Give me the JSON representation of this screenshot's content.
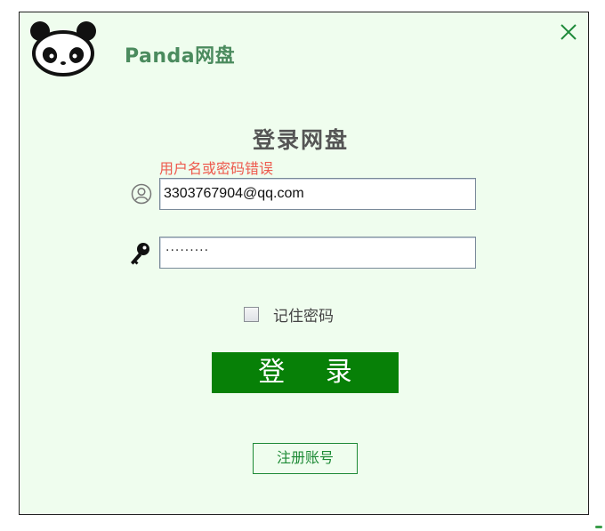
{
  "app": {
    "title": "Panda网盘"
  },
  "login": {
    "heading": "登录网盘",
    "error": "用户名或密码错误",
    "username_value": "3303767904@qq.com",
    "password_mask": "·········",
    "remember_label": "记住密码",
    "remember_checked": false,
    "login_button": "登 录",
    "register_button": "注册账号"
  },
  "icons": {
    "logo": "panda-logo",
    "close": "close-icon",
    "user": "user-icon",
    "password": "key-icon"
  },
  "colors": {
    "background": "#effdee",
    "accent": "#078007",
    "error": "#ee5a4e",
    "title": "#4b8b5e"
  }
}
